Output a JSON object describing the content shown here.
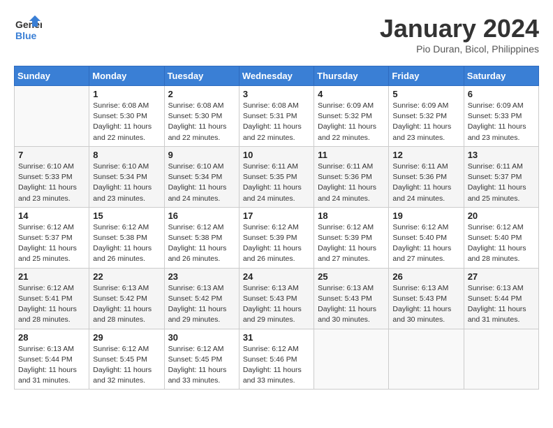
{
  "logo": {
    "line1": "General",
    "line2": "Blue"
  },
  "title": "January 2024",
  "subtitle": "Pio Duran, Bicol, Philippines",
  "days_of_week": [
    "Sunday",
    "Monday",
    "Tuesday",
    "Wednesday",
    "Thursday",
    "Friday",
    "Saturday"
  ],
  "weeks": [
    [
      {
        "day": "",
        "info": ""
      },
      {
        "day": "1",
        "info": "Sunrise: 6:08 AM\nSunset: 5:30 PM\nDaylight: 11 hours\nand 22 minutes."
      },
      {
        "day": "2",
        "info": "Sunrise: 6:08 AM\nSunset: 5:30 PM\nDaylight: 11 hours\nand 22 minutes."
      },
      {
        "day": "3",
        "info": "Sunrise: 6:08 AM\nSunset: 5:31 PM\nDaylight: 11 hours\nand 22 minutes."
      },
      {
        "day": "4",
        "info": "Sunrise: 6:09 AM\nSunset: 5:32 PM\nDaylight: 11 hours\nand 22 minutes."
      },
      {
        "day": "5",
        "info": "Sunrise: 6:09 AM\nSunset: 5:32 PM\nDaylight: 11 hours\nand 23 minutes."
      },
      {
        "day": "6",
        "info": "Sunrise: 6:09 AM\nSunset: 5:33 PM\nDaylight: 11 hours\nand 23 minutes."
      }
    ],
    [
      {
        "day": "7",
        "info": "Sunrise: 6:10 AM\nSunset: 5:33 PM\nDaylight: 11 hours\nand 23 minutes."
      },
      {
        "day": "8",
        "info": "Sunrise: 6:10 AM\nSunset: 5:34 PM\nDaylight: 11 hours\nand 23 minutes."
      },
      {
        "day": "9",
        "info": "Sunrise: 6:10 AM\nSunset: 5:34 PM\nDaylight: 11 hours\nand 24 minutes."
      },
      {
        "day": "10",
        "info": "Sunrise: 6:11 AM\nSunset: 5:35 PM\nDaylight: 11 hours\nand 24 minutes."
      },
      {
        "day": "11",
        "info": "Sunrise: 6:11 AM\nSunset: 5:36 PM\nDaylight: 11 hours\nand 24 minutes."
      },
      {
        "day": "12",
        "info": "Sunrise: 6:11 AM\nSunset: 5:36 PM\nDaylight: 11 hours\nand 24 minutes."
      },
      {
        "day": "13",
        "info": "Sunrise: 6:11 AM\nSunset: 5:37 PM\nDaylight: 11 hours\nand 25 minutes."
      }
    ],
    [
      {
        "day": "14",
        "info": "Sunrise: 6:12 AM\nSunset: 5:37 PM\nDaylight: 11 hours\nand 25 minutes."
      },
      {
        "day": "15",
        "info": "Sunrise: 6:12 AM\nSunset: 5:38 PM\nDaylight: 11 hours\nand 26 minutes."
      },
      {
        "day": "16",
        "info": "Sunrise: 6:12 AM\nSunset: 5:38 PM\nDaylight: 11 hours\nand 26 minutes."
      },
      {
        "day": "17",
        "info": "Sunrise: 6:12 AM\nSunset: 5:39 PM\nDaylight: 11 hours\nand 26 minutes."
      },
      {
        "day": "18",
        "info": "Sunrise: 6:12 AM\nSunset: 5:39 PM\nDaylight: 11 hours\nand 27 minutes."
      },
      {
        "day": "19",
        "info": "Sunrise: 6:12 AM\nSunset: 5:40 PM\nDaylight: 11 hours\nand 27 minutes."
      },
      {
        "day": "20",
        "info": "Sunrise: 6:12 AM\nSunset: 5:40 PM\nDaylight: 11 hours\nand 28 minutes."
      }
    ],
    [
      {
        "day": "21",
        "info": "Sunrise: 6:12 AM\nSunset: 5:41 PM\nDaylight: 11 hours\nand 28 minutes."
      },
      {
        "day": "22",
        "info": "Sunrise: 6:13 AM\nSunset: 5:42 PM\nDaylight: 11 hours\nand 28 minutes."
      },
      {
        "day": "23",
        "info": "Sunrise: 6:13 AM\nSunset: 5:42 PM\nDaylight: 11 hours\nand 29 minutes."
      },
      {
        "day": "24",
        "info": "Sunrise: 6:13 AM\nSunset: 5:43 PM\nDaylight: 11 hours\nand 29 minutes."
      },
      {
        "day": "25",
        "info": "Sunrise: 6:13 AM\nSunset: 5:43 PM\nDaylight: 11 hours\nand 30 minutes."
      },
      {
        "day": "26",
        "info": "Sunrise: 6:13 AM\nSunset: 5:43 PM\nDaylight: 11 hours\nand 30 minutes."
      },
      {
        "day": "27",
        "info": "Sunrise: 6:13 AM\nSunset: 5:44 PM\nDaylight: 11 hours\nand 31 minutes."
      }
    ],
    [
      {
        "day": "28",
        "info": "Sunrise: 6:13 AM\nSunset: 5:44 PM\nDaylight: 11 hours\nand 31 minutes."
      },
      {
        "day": "29",
        "info": "Sunrise: 6:12 AM\nSunset: 5:45 PM\nDaylight: 11 hours\nand 32 minutes."
      },
      {
        "day": "30",
        "info": "Sunrise: 6:12 AM\nSunset: 5:45 PM\nDaylight: 11 hours\nand 33 minutes."
      },
      {
        "day": "31",
        "info": "Sunrise: 6:12 AM\nSunset: 5:46 PM\nDaylight: 11 hours\nand 33 minutes."
      },
      {
        "day": "",
        "info": ""
      },
      {
        "day": "",
        "info": ""
      },
      {
        "day": "",
        "info": ""
      }
    ]
  ]
}
